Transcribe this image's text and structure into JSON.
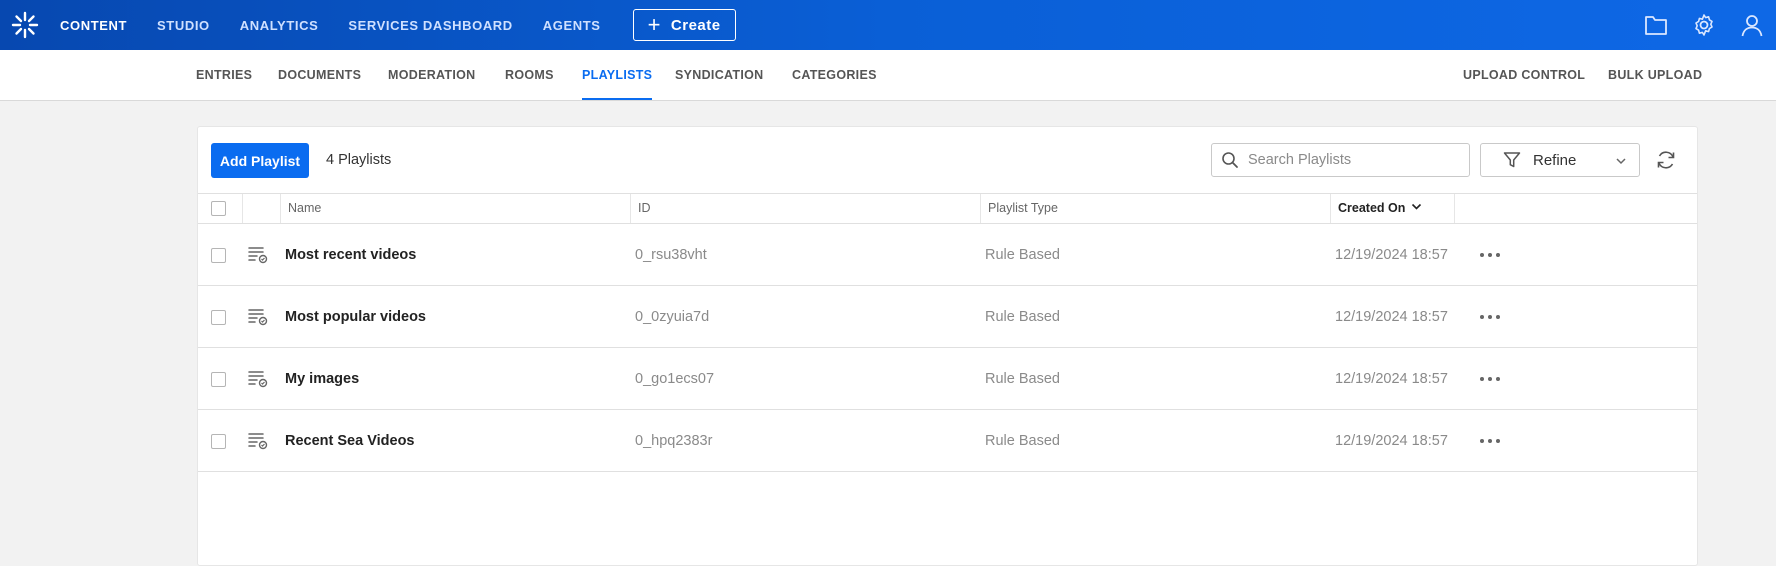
{
  "topnav": {
    "items": [
      {
        "label": "CONTENT",
        "active": true
      },
      {
        "label": "STUDIO"
      },
      {
        "label": "ANALYTICS"
      },
      {
        "label": "SERVICES DASHBOARD"
      },
      {
        "label": "AGENTS"
      }
    ],
    "create_label": "Create"
  },
  "subnav": {
    "items": [
      "ENTRIES",
      "DOCUMENTS",
      "MODERATION",
      "ROOMS",
      "PLAYLISTS",
      "SYNDICATION",
      "CATEGORIES"
    ],
    "active": "PLAYLISTS",
    "right_items": [
      "UPLOAD CONTROL",
      "BULK UPLOAD"
    ]
  },
  "toolbar": {
    "add_label": "Add Playlist",
    "count_label": "4 Playlists",
    "search_placeholder": "Search Playlists",
    "refine_label": "Refine"
  },
  "table": {
    "columns": [
      "Name",
      "ID",
      "Playlist Type",
      "Created On"
    ],
    "rows": [
      {
        "name": "Most recent videos",
        "id": "0_rsu38vht",
        "type": "Rule Based",
        "created": "12/19/2024 18:57"
      },
      {
        "name": "Most popular videos",
        "id": "0_0zyuia7d",
        "type": "Rule Based",
        "created": "12/19/2024 18:57"
      },
      {
        "name": "My images",
        "id": "0_go1ecs07",
        "type": "Rule Based",
        "created": "12/19/2024 18:57"
      },
      {
        "name": "Recent Sea Videos",
        "id": "0_hpq2383r",
        "type": "Rule Based",
        "created": "12/19/2024 18:57"
      }
    ]
  },
  "icons": {
    "logo": "kaltura-logo-icon",
    "folder": "folder-icon",
    "settings": "gear-icon",
    "user": "user-icon",
    "search": "search-icon",
    "filter": "filter-icon",
    "refresh": "refresh-icon",
    "playlist": "rule-playlist-icon",
    "more": "more-horizontal-icon"
  },
  "colors": {
    "accent": "#0a6cf0",
    "topbar": "#0a5fd6"
  }
}
